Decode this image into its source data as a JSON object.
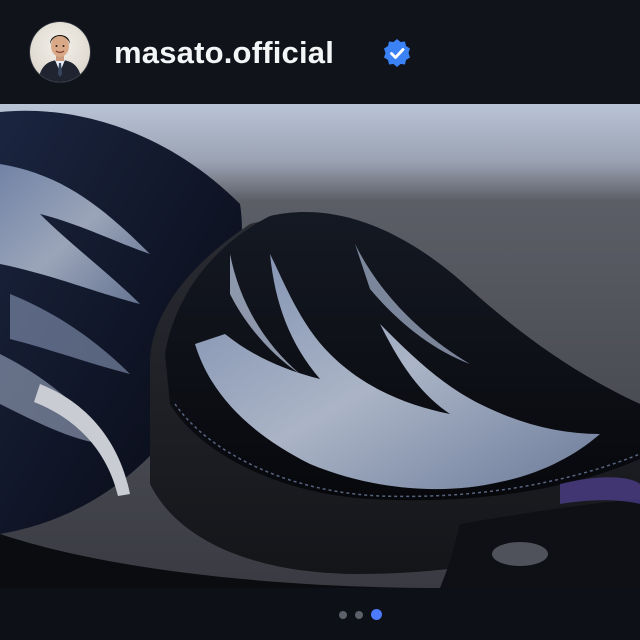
{
  "post": {
    "username": "masato.official",
    "verified": true,
    "avatar_icon": "profile-avatar",
    "verified_icon": "verified-badge-icon",
    "media": {
      "subject": "motorcycle-seat-photo",
      "carousel_dots": 3,
      "active_index": 3
    }
  },
  "colors": {
    "background": "#0d1016",
    "text": "#f4f5f7",
    "verified_blue": "#3b82f6",
    "dot_active": "#4d7bff",
    "dot_inactive": "#5b606a"
  }
}
